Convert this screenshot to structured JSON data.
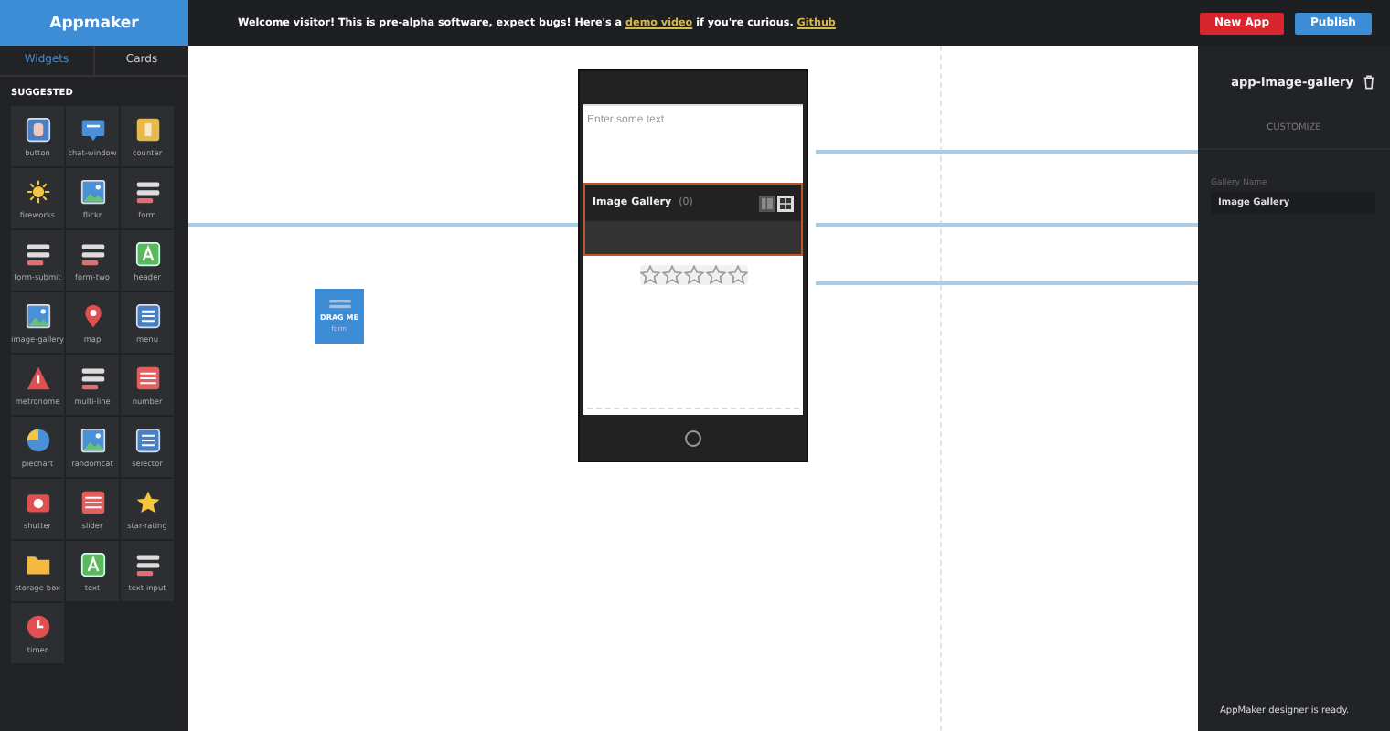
{
  "brand": "Appmaker",
  "banner": {
    "text": "Welcome visitor! This is pre-alpha software, expect bugs! Here's a",
    "link1": "demo video",
    "middle": "if you're curious.",
    "link2": "Github"
  },
  "buttons": [
    {
      "label": "New App",
      "kind": "danger"
    },
    {
      "label": "Publish",
      "kind": "primary"
    }
  ],
  "tabs": [
    {
      "label": "Widgets",
      "selected": true
    },
    {
      "label": "Cards",
      "selected": false
    }
  ],
  "section": "SUGGESTED",
  "widgets": [
    {
      "label": "button",
      "kind": "tile"
    },
    {
      "label": "chat-window",
      "kind": "chat"
    },
    {
      "label": "counter",
      "kind": "number"
    },
    {
      "label": "fireworks",
      "kind": "sun"
    },
    {
      "label": "flickr",
      "kind": "image"
    },
    {
      "label": "form",
      "kind": "lines"
    },
    {
      "label": "form-submit",
      "kind": "lines"
    },
    {
      "label": "form-two",
      "kind": "lines"
    },
    {
      "label": "header",
      "kind": "letter"
    },
    {
      "label": "image-gallery",
      "kind": "image"
    },
    {
      "label": "map",
      "kind": "pin"
    },
    {
      "label": "menu",
      "kind": "list"
    },
    {
      "label": "metronome",
      "kind": "warning"
    },
    {
      "label": "multi-line",
      "kind": "lines"
    },
    {
      "label": "number",
      "kind": "redlist"
    },
    {
      "label": "piechart",
      "kind": "pie"
    },
    {
      "label": "randomcat",
      "kind": "image"
    },
    {
      "label": "selector",
      "kind": "list"
    },
    {
      "label": "shutter",
      "kind": "camera"
    },
    {
      "label": "slider",
      "kind": "redlist"
    },
    {
      "label": "star-rating",
      "kind": "star"
    },
    {
      "label": "storage-box",
      "kind": "folder"
    },
    {
      "label": "text",
      "kind": "letter"
    },
    {
      "label": "text-input",
      "kind": "lines"
    },
    {
      "label": "timer",
      "kind": "clock"
    }
  ],
  "drag_tile": {
    "title": "DRAG ME",
    "subtitle": "form"
  },
  "phone": {
    "text_field": {
      "placeholder": "Enter some text"
    },
    "gallery": {
      "title": "Image Gallery",
      "count": "(0)",
      "views": [
        {
          "kind": "list",
          "selected": false
        },
        {
          "kind": "grid",
          "selected": true
        }
      ]
    },
    "rating": {
      "stars": 0
    }
  },
  "inspector": {
    "title": "app-image-gallery",
    "heading": "CUSTOMIZE",
    "field_label": "Gallery Name",
    "field_value": "Image Gallery"
  },
  "status": "AppMaker designer is ready."
}
